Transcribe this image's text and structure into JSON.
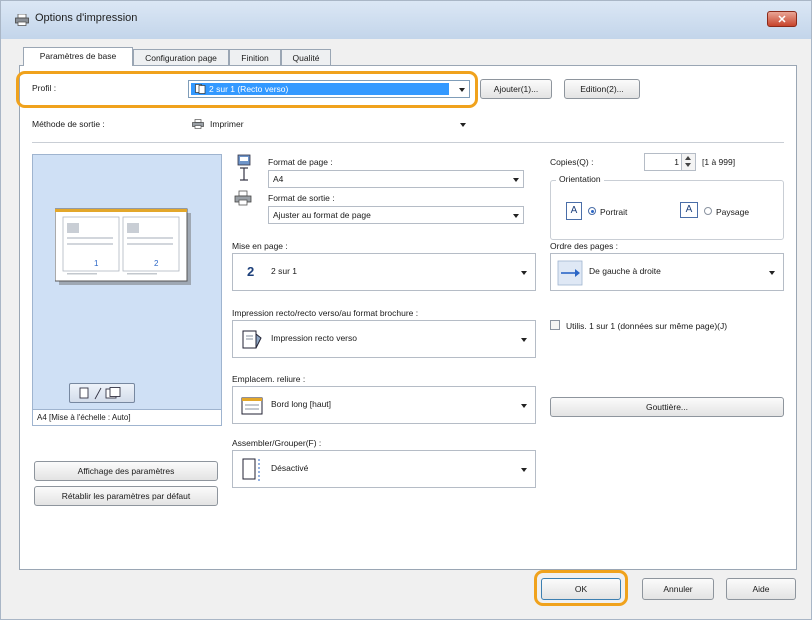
{
  "window": {
    "title": "Options d'impression",
    "close_label": "✕"
  },
  "tabs": [
    {
      "label": "Paramètres de base"
    },
    {
      "label": "Configuration page"
    },
    {
      "label": "Finition"
    },
    {
      "label": "Qualité"
    }
  ],
  "profile": {
    "label": "Profil :",
    "value": "2 sur 1 (Recto verso)",
    "add_button": "Ajouter(1)...",
    "edit_button": "Edition(2)..."
  },
  "output_method": {
    "label": "Méthode de sortie :",
    "value": "Imprimer"
  },
  "preview": {
    "caption": "A4 [Mise à l'échelle : Auto]",
    "page_numbers": [
      "1",
      "2"
    ]
  },
  "page_size": {
    "label": "Format de page :",
    "value": "A4"
  },
  "output_size": {
    "label": "Format de sortie :",
    "value": "Ajuster au format de page"
  },
  "copies": {
    "label": "Copies(Q) :",
    "value": "1",
    "range": "[1 à 999]"
  },
  "orientation": {
    "label": "Orientation",
    "portrait": "Portrait",
    "landscape": "Paysage",
    "icon_letter": "A"
  },
  "layout": {
    "label": "Mise en page :",
    "value": "2 sur 1",
    "icon_digit": "2"
  },
  "page_order": {
    "label": "Ordre des pages :",
    "value": "De gauche à droite"
  },
  "duplex": {
    "label": "Impression recto/recto verso/au format brochure :",
    "value": "Impression recto verso"
  },
  "use_1on1": {
    "label": "Utilis. 1 sur 1 (données sur même page)(J)"
  },
  "binding": {
    "label": "Emplacem. reliure :",
    "value": "Bord long [haut]"
  },
  "gutter_button": "Gouttière...",
  "collate": {
    "label": "Assembler/Grouper(F) :",
    "value": "Désactivé"
  },
  "left_buttons": {
    "show_settings": "Affichage des paramètres",
    "restore_defaults": "Rétablir les paramètres par défaut"
  },
  "footer": {
    "ok": "OK",
    "cancel": "Annuler",
    "help": "Aide"
  },
  "colors": {
    "highlight": "#f0a21c",
    "accent": "#2b66c6",
    "selection": "#3399ff"
  }
}
